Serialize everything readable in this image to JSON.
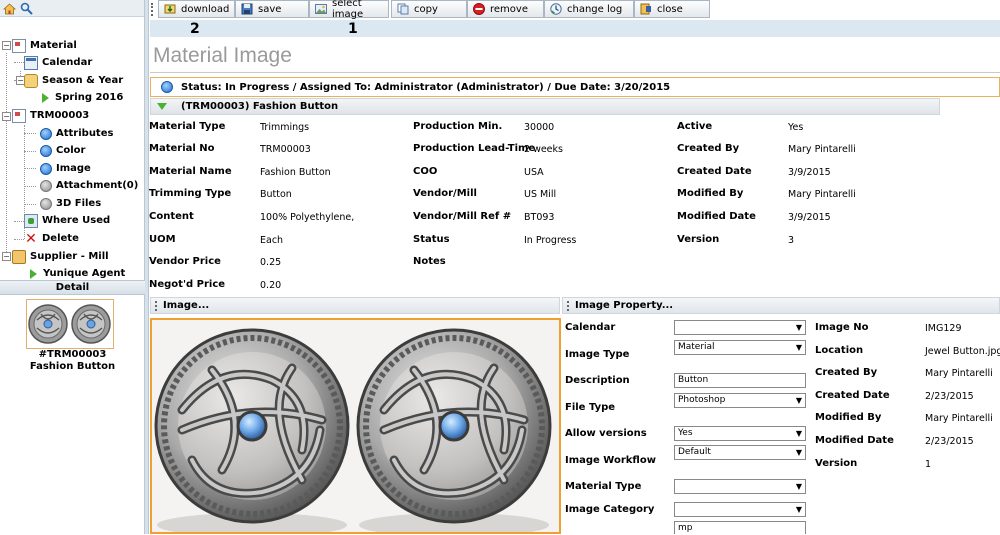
{
  "toolbar": {
    "buttons": [
      "download",
      "save",
      "select image",
      "copy",
      "remove",
      "change log",
      "close"
    ]
  },
  "annotations": {
    "n1": "1",
    "n2": "2"
  },
  "nav": {
    "items": [
      "Material",
      "Calendar",
      "Season & Year",
      "Spring 2016",
      "TRM00003",
      "Attributes",
      "Color",
      "Image",
      "Attachment(0)",
      "3D Files",
      "Where Used",
      "Delete",
      "Supplier - Mill",
      "Yunique Agent"
    ],
    "detail_header": "Detail",
    "detail_caption_line1": "#TRM00003",
    "detail_caption_line2": "Fashion Button"
  },
  "page": {
    "title": "Material Image",
    "status": "Status: In Progress / Assigned To: Administrator (Administrator) / Due Date: 3/20/2015",
    "section": "(TRM00003) Fashion Button"
  },
  "fields": {
    "col1": [
      {
        "label": "Material Type",
        "value": "Trimmings"
      },
      {
        "label": "Material No",
        "value": "TRM00003"
      },
      {
        "label": "Material Name",
        "value": "Fashion Button"
      },
      {
        "label": "Trimming Type",
        "value": "Button"
      },
      {
        "label": "Content",
        "value": "100% Polyethylene,"
      },
      {
        "label": "UOM",
        "value": "Each"
      },
      {
        "label": "Vendor Price",
        "value": "0.25"
      },
      {
        "label": "Negot'd Price",
        "value": "0.20"
      }
    ],
    "col2": [
      {
        "label": "Production Min.",
        "value": "30000"
      },
      {
        "label": "Production Lead-Time",
        "value": "2 weeks"
      },
      {
        "label": "COO",
        "value": "USA"
      },
      {
        "label": "Vendor/Mill",
        "value": "US Mill"
      },
      {
        "label": "Vendor/Mill Ref #",
        "value": "BT093"
      },
      {
        "label": "Status",
        "value": "In Progress"
      },
      {
        "label": "Notes",
        "value": ""
      }
    ],
    "col3": [
      {
        "label": "Active",
        "value": "Yes"
      },
      {
        "label": "Created By",
        "value": "Mary Pintarelli"
      },
      {
        "label": "Created Date",
        "value": "3/9/2015"
      },
      {
        "label": "Modified By",
        "value": "Mary Pintarelli"
      },
      {
        "label": "Modified Date",
        "value": "3/9/2015"
      },
      {
        "label": "Version",
        "value": "3"
      }
    ]
  },
  "image_panel": {
    "header": "Image..."
  },
  "property_panel": {
    "header": "Image Property...",
    "form": [
      {
        "label": "Calendar",
        "value": ""
      },
      {
        "label": "Image Type",
        "value": "Material"
      },
      {
        "label": "Description",
        "value": "Button"
      },
      {
        "label": "File Type",
        "value": "Photoshop"
      },
      {
        "label": "Allow versions",
        "value": "Yes"
      },
      {
        "label": "Image Workflow",
        "value": "Default"
      },
      {
        "label": "Material Type",
        "value": ""
      },
      {
        "label": "Image Category",
        "value": ""
      },
      {
        "label": "",
        "value": "mp"
      }
    ],
    "info": [
      {
        "label": "Image No",
        "value": "IMG129"
      },
      {
        "label": "Location",
        "value": "Jewel Button.jpg"
      },
      {
        "label": "Created By",
        "value": "Mary Pintarelli"
      },
      {
        "label": "Created Date",
        "value": "2/23/2015"
      },
      {
        "label": "Modified By",
        "value": "Mary Pintarelli"
      },
      {
        "label": "Modified Date",
        "value": "2/23/2015"
      },
      {
        "label": "Version",
        "value": "1"
      }
    ]
  },
  "colors": {
    "accent_orange": "#f0a030",
    "header_blue": "#dbe7f1"
  }
}
